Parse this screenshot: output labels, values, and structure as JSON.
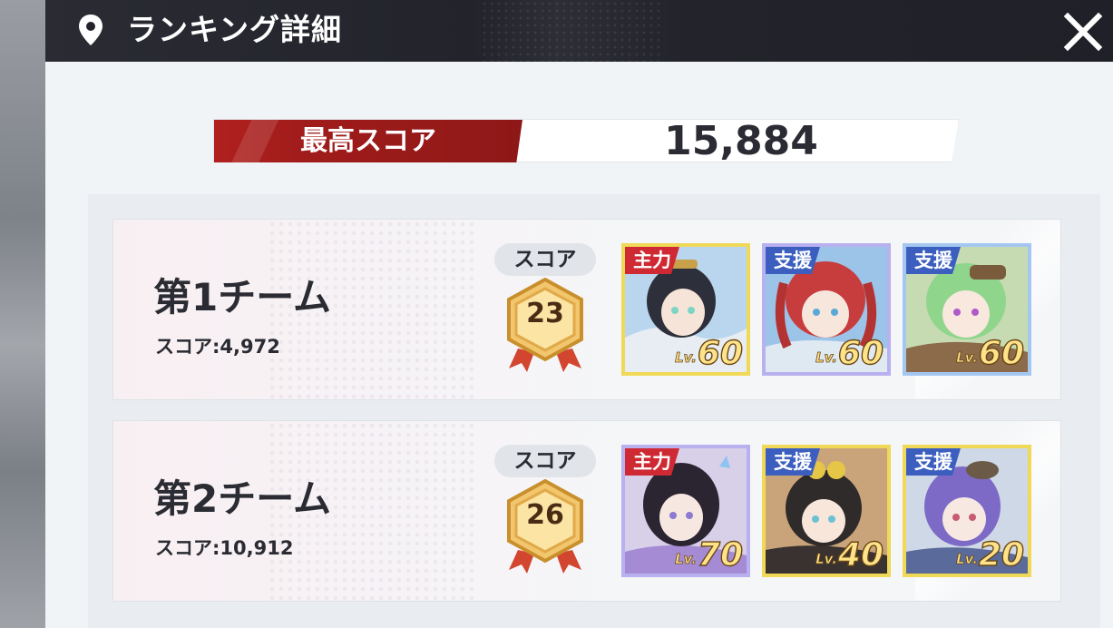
{
  "dialog": {
    "title": "ランキング詳細",
    "icons": {
      "title": "location-pin-icon",
      "close": "close-icon"
    }
  },
  "best_score": {
    "label": "最高スコア",
    "value": "15,884"
  },
  "colors": {
    "title_bar": "#23242b",
    "accent_red": "#a01c1b",
    "role_main": "#cf2a33",
    "role_support": "#3c5fbf",
    "medal_gold": "#e6b25a"
  },
  "teams": [
    {
      "name": "第1チーム",
      "score_text": "スコア:4,972",
      "score_pill": "スコア",
      "rank": "23",
      "members": [
        {
          "role": "主力",
          "level_label": "Lv.",
          "level": "60"
        },
        {
          "role": "支援",
          "level_label": "Lv.",
          "level": "60"
        },
        {
          "role": "支援",
          "level_label": "Lv.",
          "level": "60"
        }
      ]
    },
    {
      "name": "第2チーム",
      "score_text": "スコア:10,912",
      "score_pill": "スコア",
      "rank": "26",
      "members": [
        {
          "role": "主力",
          "level_label": "Lv.",
          "level": "70"
        },
        {
          "role": "支援",
          "level_label": "Lv.",
          "level": "40"
        },
        {
          "role": "支援",
          "level_label": "Lv.",
          "level": "20"
        }
      ]
    }
  ]
}
